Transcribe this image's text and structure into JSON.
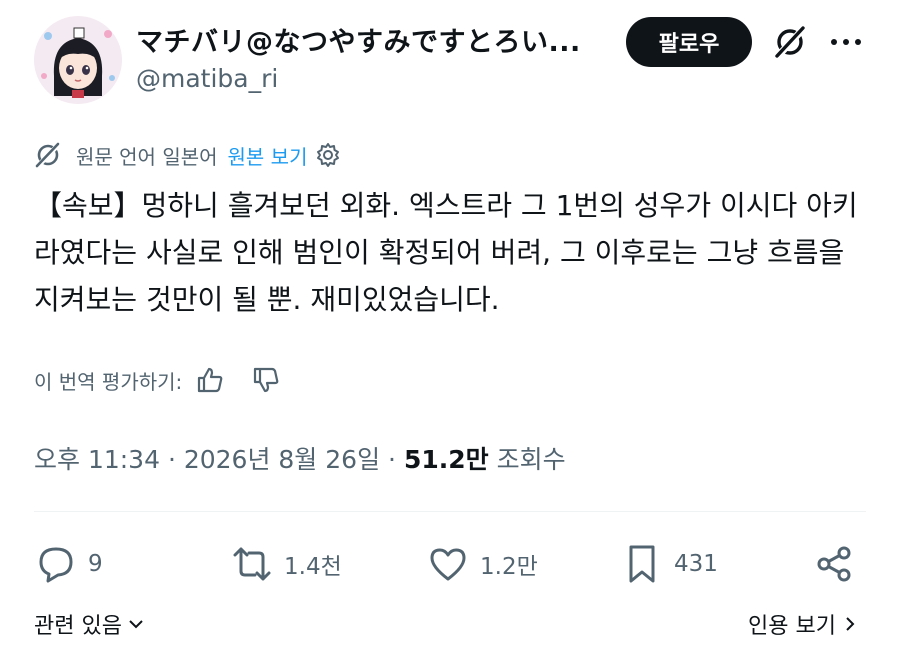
{
  "author": {
    "display_name": "マチバリ@なつやすみですとろい...",
    "handle": "@matiba_ri",
    "avatar_icon": "profile-avatar"
  },
  "header": {
    "follow_label": "팔로우",
    "grok_icon": "grok-icon",
    "more_icon": "more-icon"
  },
  "translation": {
    "source_language": "원문 언어 일본어",
    "view_original": "원본 보기"
  },
  "tweet": {
    "text": "【속보】멍하니 흘겨보던 외화. 엑스트라 그 1번의 성우가 이시다 아키라였다는 사실로 인해 범인이 확정되어 버려, 그 이후로는 그냥 흐름을 지켜보는 것만이 될 뿐. 재미있었습니다."
  },
  "rate_translation": {
    "label": "이 번역 평가하기:"
  },
  "meta": {
    "timestamp": "오후 11:34 · 2026년 8월 26일 ·",
    "views_count": "51.2만",
    "views_label": "조회수"
  },
  "actions": {
    "replies": "9",
    "reposts": "1.4천",
    "likes": "1.2만",
    "bookmarks": "431"
  },
  "footer": {
    "related_label": "관련 있음",
    "quotes_label": "인용 보기"
  },
  "colors": {
    "text_primary": "#0f1419",
    "text_secondary": "#536471",
    "link": "#1d9bf0",
    "follow_bg": "#0f1419"
  }
}
